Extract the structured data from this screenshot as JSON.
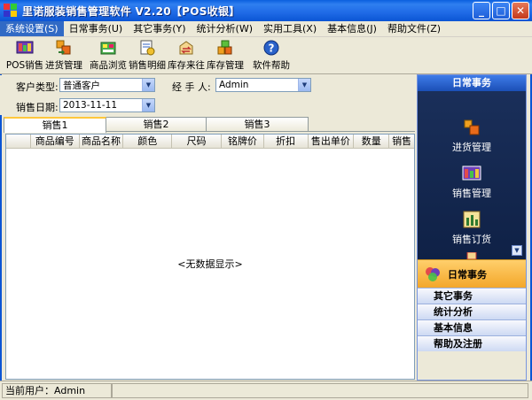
{
  "window": {
    "title": "里诺服装销售管理软件 V2.20【POS收银】"
  },
  "menu": [
    {
      "label": "系统设置(S)",
      "active": true
    },
    {
      "label": "日常事务(U)"
    },
    {
      "label": "其它事务(Y)"
    },
    {
      "label": "统计分析(W)"
    },
    {
      "label": "实用工具(X)"
    },
    {
      "label": "基本信息(J)"
    },
    {
      "label": "帮助文件(Z)"
    }
  ],
  "toolbar": [
    {
      "label": "POS销售",
      "icon": "pos-sales-icon"
    },
    {
      "label": "进货管理",
      "icon": "purchase-icon"
    },
    {
      "label": "商品浏览",
      "icon": "browse-icon"
    },
    {
      "label": "销售明细",
      "icon": "sales-detail-icon"
    },
    {
      "label": "库存来往",
      "icon": "stock-flow-icon"
    },
    {
      "label": "库存管理",
      "icon": "stock-manage-icon"
    },
    {
      "label": "软件帮助",
      "icon": "help-icon"
    }
  ],
  "form": {
    "customer_type_label": "客户类型:",
    "customer_type_value": "普通客户",
    "handler_label": "经 手 人:",
    "handler_value": "Admin",
    "sale_date_label": "销售日期:",
    "sale_date_value": "2013-11-11"
  },
  "tabs": [
    "销售1",
    "销售2",
    "销售3"
  ],
  "grid": {
    "columns": [
      "商品编号",
      "商品名称",
      "颜色",
      "尺码",
      "铭牌价",
      "折扣",
      "售出单价",
      "数量",
      "销售"
    ],
    "empty_message": "<无数据显示>"
  },
  "right_panel": {
    "header": "日常事务",
    "items": [
      {
        "label": "进货管理"
      },
      {
        "label": "销售管理"
      },
      {
        "label": "销售订货"
      }
    ],
    "active_category": "日常事务",
    "categories": [
      "其它事务",
      "统计分析",
      "基本信息",
      "帮助及注册"
    ]
  },
  "status": {
    "current_user": "当前用户：Admin"
  },
  "colors": {
    "title_blue": "#0b55d4",
    "menu_highlight": "#316ac5",
    "panel_dark": "#13264f",
    "active_orange": "#f3a72a"
  }
}
